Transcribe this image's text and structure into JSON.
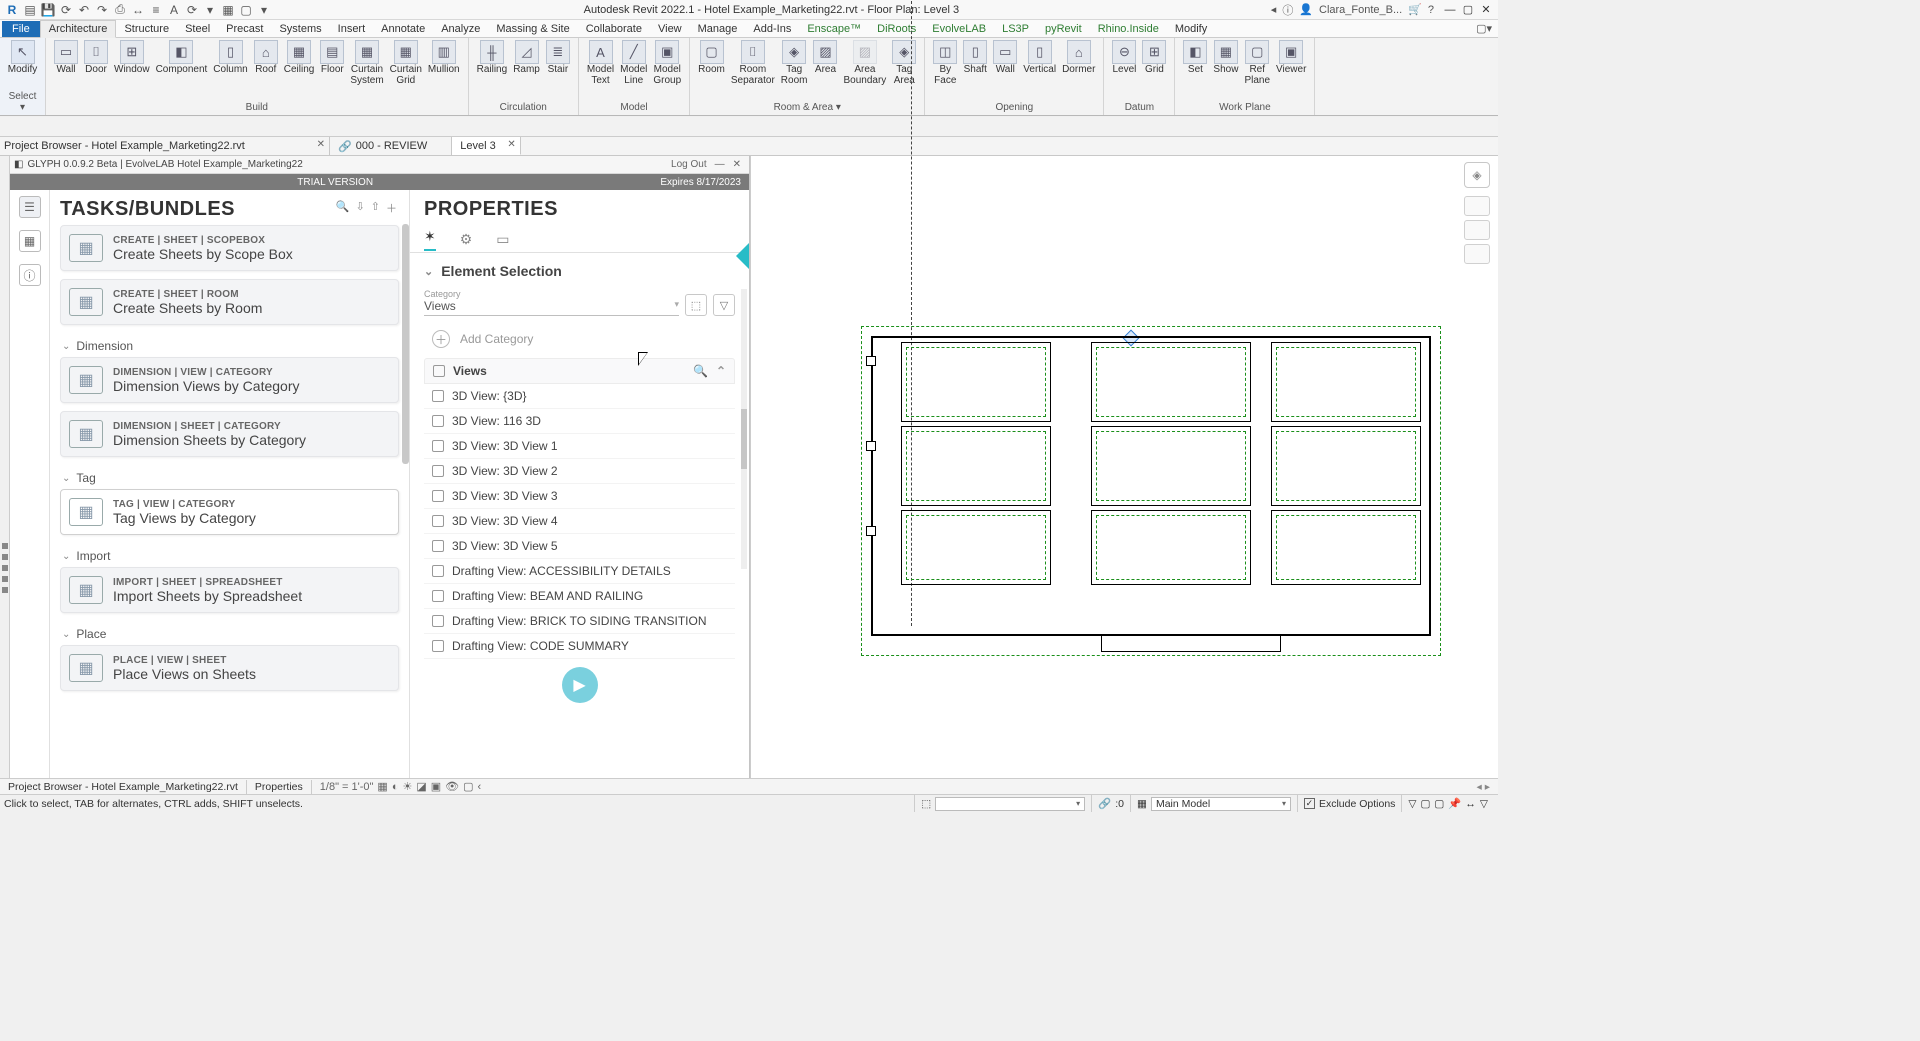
{
  "title": "Autodesk Revit 2022.1 - Hotel Example_Marketing22.rvt - Floor Plan: Level 3",
  "user": "Clara_Fonte_B...",
  "menutabs": {
    "file": "File",
    "items": [
      "Architecture",
      "Structure",
      "Steel",
      "Precast",
      "Systems",
      "Insert",
      "Annotate",
      "Analyze",
      "Massing & Site",
      "Collaborate",
      "View",
      "Manage",
      "Add-Ins",
      "Enscape™",
      "DiRoots",
      "EvolveLAB",
      "LS3P",
      "pyRevit",
      "Rhino.Inside",
      "Modify"
    ]
  },
  "ribbon": {
    "modify": {
      "label": "Modify",
      "sel": "Select ▾"
    },
    "groups": [
      {
        "name": "Build",
        "items": [
          {
            "l": "Wall",
            "g": "▭"
          },
          {
            "l": "Door",
            "g": "⌷"
          },
          {
            "l": "Window",
            "g": "⊞"
          },
          {
            "l": "Component",
            "g": "◧"
          },
          {
            "l": "Column",
            "g": "▯"
          },
          {
            "l": "Roof",
            "g": "⌂"
          },
          {
            "l": "Ceiling",
            "g": "▦"
          },
          {
            "l": "Floor",
            "g": "▤"
          },
          {
            "l": "Curtain",
            "l2": "System",
            "g": "▦"
          },
          {
            "l": "Curtain",
            "l2": "Grid",
            "g": "▦"
          },
          {
            "l": "Mullion",
            "g": "▥"
          }
        ]
      },
      {
        "name": "Circulation",
        "items": [
          {
            "l": "Railing",
            "g": "╫"
          },
          {
            "l": "Ramp",
            "g": "◿"
          },
          {
            "l": "Stair",
            "g": "≣"
          }
        ]
      },
      {
        "name": "Model",
        "items": [
          {
            "l": "Model",
            "l2": "Text",
            "g": "A"
          },
          {
            "l": "Model",
            "l2": "Line",
            "g": "╱"
          },
          {
            "l": "Model",
            "l2": "Group",
            "g": "▣"
          }
        ]
      },
      {
        "name": "Room & Area ▾",
        "items": [
          {
            "l": "Room",
            "g": "▢"
          },
          {
            "l": "Room",
            "l2": "Separator",
            "g": "⌷"
          },
          {
            "l": "Tag",
            "l2": "Room",
            "g": "◈"
          },
          {
            "l": "Area",
            "g": "▨"
          },
          {
            "l": "Area",
            "l2": "Boundary",
            "g": "▨",
            "dim": true
          },
          {
            "l": "Tag",
            "l2": "Area",
            "g": "◈"
          }
        ]
      },
      {
        "name": "Opening",
        "items": [
          {
            "l": "By",
            "l2": "Face",
            "g": "◫"
          },
          {
            "l": "Shaft",
            "g": "▯"
          },
          {
            "l": "Wall",
            "g": "▭"
          },
          {
            "l": "Vertical",
            "g": "▯"
          },
          {
            "l": "Dormer",
            "g": "⌂"
          }
        ]
      },
      {
        "name": "Datum",
        "items": [
          {
            "l": "Level",
            "g": "⊖"
          },
          {
            "l": "Grid",
            "g": "⊞"
          }
        ]
      },
      {
        "name": "Work Plane",
        "items": [
          {
            "l": "Set",
            "g": "◧"
          },
          {
            "l": "Show",
            "g": "▦"
          },
          {
            "l": "Ref",
            "l2": "Plane",
            "g": "▢"
          },
          {
            "l": "Viewer",
            "g": "▣"
          }
        ]
      }
    ]
  },
  "doctabs": {
    "project_browser": "Project Browser - Hotel Example_Marketing22.rvt",
    "t2": "000 - REVIEW",
    "t3": "Level 3"
  },
  "glyph": {
    "header_left": "GLYPH 0.0.9.2 Beta  | EvolveLAB   Hotel Example_Marketing22",
    "logout": "Log Out",
    "trial": "TRIAL VERSION",
    "expires": "Expires 8/17/2023",
    "tasks_title": "TASKS/BUNDLES",
    "sections": [
      {
        "head": null,
        "cards": [
          {
            "bc": "CREATE  |  SHEET  |  SCOPEBOX",
            "ttl": "Create Sheets by Scope Box"
          },
          {
            "bc": "CREATE  |  SHEET  |  ROOM",
            "ttl": "Create Sheets by Room"
          }
        ]
      },
      {
        "head": "Dimension",
        "cards": [
          {
            "bc": "DIMENSION  |  VIEW  |  CATEGORY",
            "ttl": "Dimension Views by Category"
          },
          {
            "bc": "DIMENSION  |  SHEET  |  CATEGORY",
            "ttl": "Dimension Sheets by Category"
          }
        ]
      },
      {
        "head": "Tag",
        "cards": [
          {
            "bc": "TAG  |  VIEW  |  CATEGORY",
            "ttl": "Tag Views by Category",
            "sel": true
          }
        ]
      },
      {
        "head": "Import",
        "cards": [
          {
            "bc": "IMPORT  |  SHEET  |  SPREADSHEET",
            "ttl": "Import Sheets by Spreadsheet"
          }
        ]
      },
      {
        "head": "Place",
        "cards": [
          {
            "bc": "PLACE  |  VIEW  |  SHEET",
            "ttl": "Place Views on Sheets"
          }
        ]
      }
    ],
    "props_title": "PROPERTIES",
    "el_sel": "Element Selection",
    "cat_label": "Category",
    "cat_value": "Views",
    "add_cat": "Add Category",
    "views_head": "Views",
    "views": [
      "3D View: {3D}",
      "3D View: 116 3D",
      "3D View: 3D View 1",
      "3D View: 3D View 2",
      "3D View: 3D View 3",
      "3D View: 3D View 4",
      "3D View: 3D View 5",
      "Drafting View: ACCESSIBILITY DETAILS",
      "Drafting View: BEAM AND RAILING",
      "Drafting View: BRICK TO SIDING TRANSITION",
      "Drafting View: CODE SUMMARY"
    ]
  },
  "footer": {
    "t1": "Project Browser - Hotel Example_Marketing22.rvt",
    "t2": "Properties",
    "scale": "1/8\" = 1'-0\""
  },
  "status": {
    "msg": "Click to select, TAB for alternates, CTRL adds, SHIFT unselects.",
    "zero": ":0",
    "model": "Main Model",
    "exclude": "Exclude Options"
  }
}
